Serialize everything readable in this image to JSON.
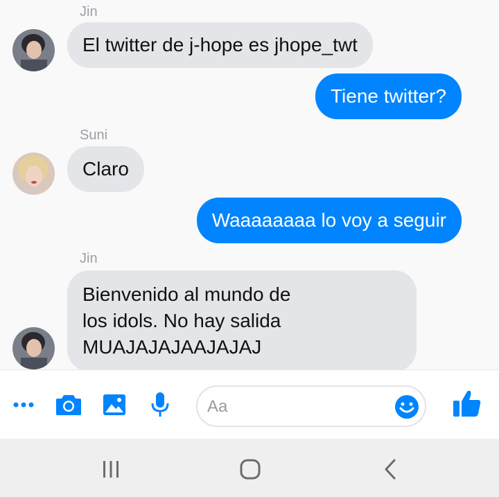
{
  "messages": [
    {
      "sender": "Jin",
      "text": "El twitter de j-hope es jhope_twt"
    },
    {
      "text": "Tiene twitter?"
    },
    {
      "sender": "Suni",
      "text": "Claro"
    },
    {
      "text": "Waaaaaaaa lo voy a seguir"
    },
    {
      "sender": "Jin",
      "lines": [
        "Bienvenido al mundo de",
        "los idols. No hay salida",
        "MUAJAJAJAAJAJAJ"
      ]
    }
  ],
  "composer": {
    "placeholder": "Aa"
  },
  "icons": [
    "more-icon",
    "camera-icon",
    "image-icon",
    "microphone-icon",
    "emoji-icon",
    "thumbs-up-icon",
    "recent-apps-icon",
    "home-icon",
    "back-icon"
  ],
  "colors": {
    "accent": "#0084ff",
    "incoming_bubble": "#e4e5e9",
    "background": "#f9f9f9"
  }
}
